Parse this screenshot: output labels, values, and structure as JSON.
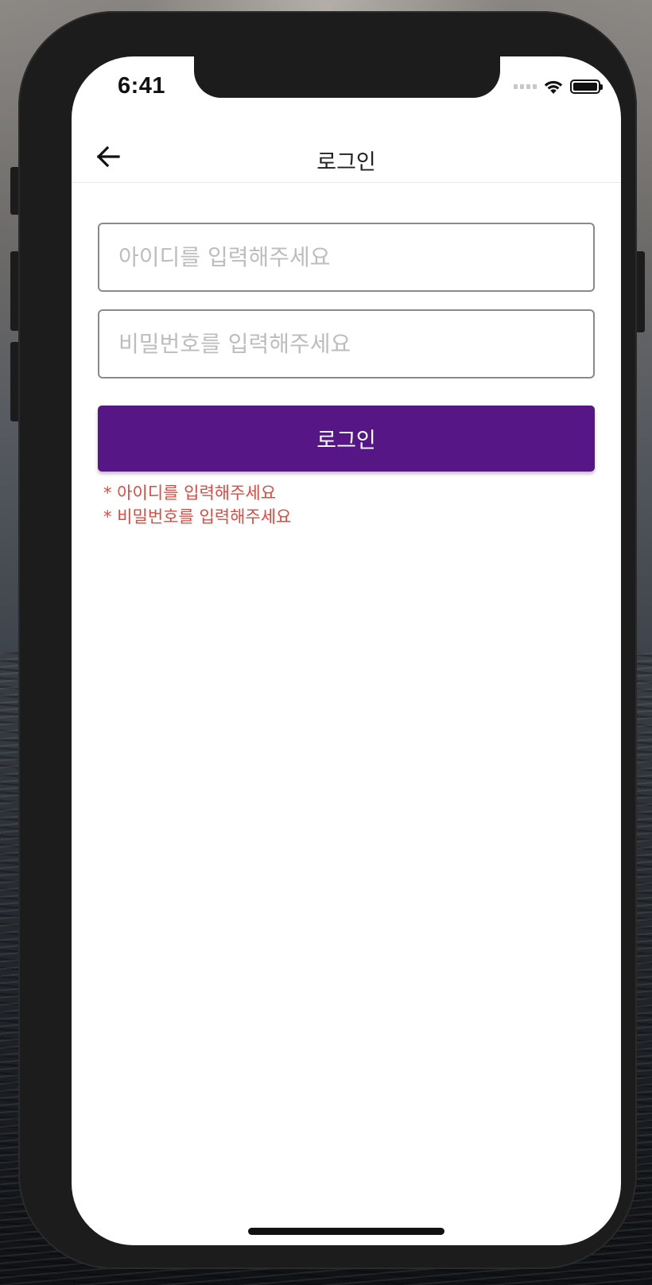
{
  "status_bar": {
    "time": "6:41",
    "icons": [
      "signal-icon",
      "wifi-icon",
      "battery-icon"
    ]
  },
  "header": {
    "back_icon": "arrow-left-icon",
    "title": "로그인"
  },
  "form": {
    "id_input": {
      "placeholder": "아이디를 입력해주세요",
      "value": ""
    },
    "password_input": {
      "placeholder": "비밀번호를 입력해주세요",
      "value": ""
    },
    "login_button_label": "로그인"
  },
  "errors": [
    "* 아이디를 입력해주세요",
    "* 비밀번호를 입력해주세요"
  ],
  "colors": {
    "primary": "#561686",
    "error": "#e5473d",
    "placeholder": "#bdbdbd"
  }
}
